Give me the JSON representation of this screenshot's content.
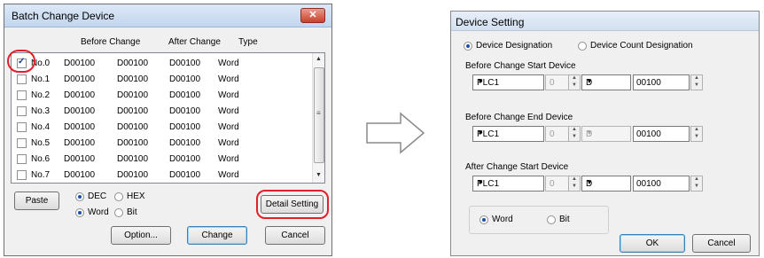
{
  "batch_dialog": {
    "title": "Batch Change Device",
    "close_glyph": "✕",
    "columns": [
      "Before Change",
      "After Change",
      "Type"
    ],
    "rows": [
      {
        "label": "No.0",
        "before1": "D00100",
        "before2": "D00100",
        "after": "D00100",
        "type": "Word",
        "checked": true
      },
      {
        "label": "No.1",
        "before1": "D00100",
        "before2": "D00100",
        "after": "D00100",
        "type": "Word",
        "checked": false
      },
      {
        "label": "No.2",
        "before1": "D00100",
        "before2": "D00100",
        "after": "D00100",
        "type": "Word",
        "checked": false
      },
      {
        "label": "No.3",
        "before1": "D00100",
        "before2": "D00100",
        "after": "D00100",
        "type": "Word",
        "checked": false
      },
      {
        "label": "No.4",
        "before1": "D00100",
        "before2": "D00100",
        "after": "D00100",
        "type": "Word",
        "checked": false
      },
      {
        "label": "No.5",
        "before1": "D00100",
        "before2": "D00100",
        "after": "D00100",
        "type": "Word",
        "checked": false
      },
      {
        "label": "No.6",
        "before1": "D00100",
        "before2": "D00100",
        "after": "D00100",
        "type": "Word",
        "checked": false
      },
      {
        "label": "No.7",
        "before1": "D00100",
        "before2": "D00100",
        "after": "D00100",
        "type": "Word",
        "checked": false
      }
    ],
    "paste_label": "Paste",
    "dec_label": "DEC",
    "hex_label": "HEX",
    "word_label": "Word",
    "bit_label": "Bit",
    "detail_setting_label": "Detail Setting",
    "option_label": "Option...",
    "change_label": "Change",
    "cancel_label": "Cancel"
  },
  "device_dialog": {
    "title": "Device Setting",
    "designation_label": "Device Designation",
    "count_designation_label": "Device Count Designation",
    "before_start_label": "Before Change Start Device",
    "before_end_label": "Before Change End Device",
    "after_start_label": "After Change Start Device",
    "plc": "PLC1",
    "station": "0",
    "device_type": "D",
    "address": "00100",
    "word_label": "Word",
    "bit_label": "Bit",
    "ok_label": "OK",
    "cancel_label": "Cancel"
  },
  "colors": {
    "highlight_ring": "#e2202a",
    "arrow_outline": "#8a8a8a"
  },
  "icons": [
    "close-icon",
    "checkbox-icon",
    "scroll-up-icon",
    "scroll-down-icon",
    "dropdown-arrow-icon",
    "spin-arrows-icon",
    "right-arrow-icon"
  ]
}
